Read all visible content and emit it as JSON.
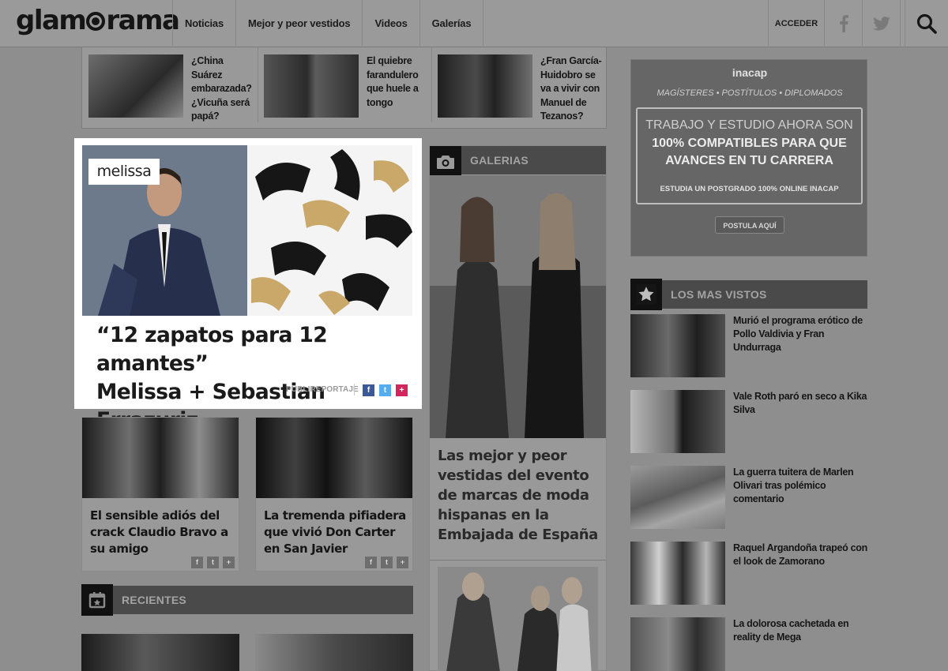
{
  "header": {
    "logo_before": "glam",
    "logo_after": "rama",
    "nav": [
      "Noticias",
      "Mejor y peor vestidos",
      "Videos",
      "Galerías"
    ],
    "acceder": "ACCEDER",
    "icons": [
      "facebook-icon",
      "twitter-icon",
      "search-icon"
    ]
  },
  "top_strip": [
    {
      "title": "¿China Suárez embarazada? ¿Vicuña será papá?"
    },
    {
      "title": "El quiebre farandulero que huele a tongo"
    },
    {
      "title": "¿Fran García-Huidobro se va a vivir con Manuel de Tezanos?"
    }
  ],
  "featured": {
    "brand_badge": "melissa",
    "title_line1": "“12 zapatos para 12 amantes”",
    "title_line2": "Melissa + Sebastian Errazuriz",
    "tag": "PUBLIREPORTAJE",
    "share": {
      "facebook": "f",
      "twitter": "t",
      "plus": "+"
    },
    "share_colors": {
      "facebook": "#3b5998",
      "twitter": "#55acee",
      "plus": "#d6245e"
    }
  },
  "cards": [
    {
      "title": "El sensible adiós del crack Claudio Bravo a su amigo"
    },
    {
      "title": "La tremenda pifiadera que vivió Don Carter en San Javier"
    }
  ],
  "mini_share": {
    "facebook": "f",
    "twitter": "t",
    "plus": "+"
  },
  "recientes": {
    "label": "RECIENTES"
  },
  "galerias": {
    "label": "GALERIAS",
    "title": "Las mejor y peor vestidas del evento de marcas de moda hispanas en la Embajada de España"
  },
  "ad": {
    "logo": "inacap",
    "sub": "MAGÍSTERES • POSTÍTULOS • DIPLOMADOS",
    "line1": "TRABAJO Y ESTUDIO AHORA SON",
    "line2": "100% COMPATIBLES PARA QUE",
    "line3": "AVANCES EN TU CARRERA",
    "line4": "ESTUDIA UN POSTGRADO 100% ONLINE INACAP",
    "button": "POSTULA AQUÍ"
  },
  "most_viewed": {
    "label": "LOS MAS VISTOS",
    "items": [
      {
        "title": "Murió el programa erótico de Pollo Valdivia y Fran Undurraga"
      },
      {
        "title": "Vale Roth paró en seco a Kika Silva"
      },
      {
        "title": "La guerra tuitera de Marlen Olivari tras polémico comentario"
      },
      {
        "title": "Raquel Argandoña trapeó con el look de Zamorano"
      },
      {
        "title": "La dolorosa cachetada en reality de Mega"
      }
    ]
  }
}
